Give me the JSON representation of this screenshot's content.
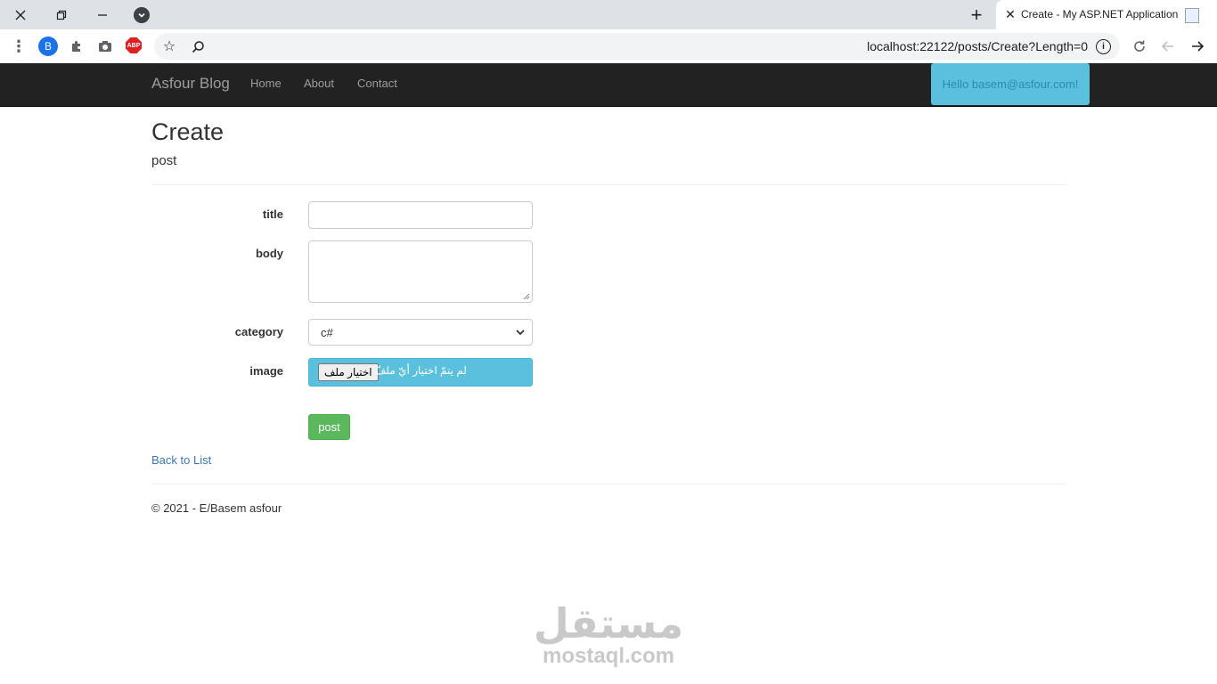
{
  "browser": {
    "tab_title": "Create - My ASP.NET Application",
    "profile_initial": "B",
    "abp_label": "ABP",
    "url": "localhost:22122/posts/Create?Length=0",
    "icons": [
      "close-icon",
      "restore-icon",
      "minimize-icon",
      "tab-search-icon",
      "new-tab-icon",
      "menu-icon",
      "extensions-icon",
      "camera-icon",
      "star-icon",
      "zoom-icon",
      "info-icon",
      "reload-icon",
      "back-icon",
      "forward-icon"
    ]
  },
  "nav": {
    "brand": "Asfour Blog",
    "links": [
      "Home",
      "About",
      "Contact"
    ],
    "user_greeting": "Hello basem@asfour.com!"
  },
  "page": {
    "title": "Create",
    "subtitle": "post"
  },
  "form": {
    "title_label": "title",
    "title_value": "",
    "body_label": "body",
    "body_value": "",
    "category_label": "category",
    "category_value": "c#",
    "image_label": "image",
    "file_button": "اختيار ملف",
    "file_status": "لم يتمّ اختيار أيّ ملفّ",
    "submit": "post"
  },
  "back_link": "Back to List",
  "footer": "© 2021 - E/Basem asfour",
  "watermark": {
    "arabic": "مستقل",
    "latin": "mostaql.com"
  },
  "colors": {
    "navbar": "#222222",
    "info": "#5bc0de",
    "success": "#5cb85c",
    "link": "#337ab7"
  }
}
